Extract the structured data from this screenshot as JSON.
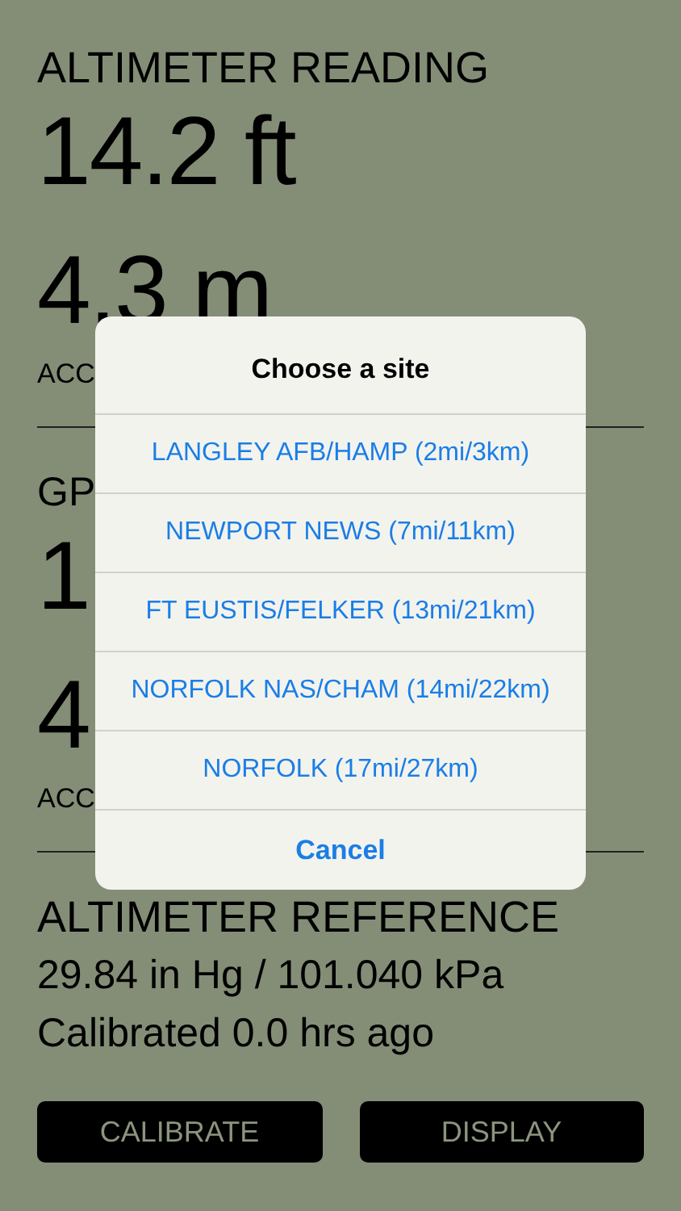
{
  "altimeter_reading": {
    "heading": "ALTIMETER READING",
    "feet": "14.2 ft",
    "meters": "4.3 m",
    "accuracy_label": "ACC"
  },
  "gps": {
    "heading": "GP",
    "feet": "1",
    "meters": "4",
    "accuracy_label": "ACC"
  },
  "altimeter_reference": {
    "heading": "ALTIMETER REFERENCE",
    "pressure": "29.84 in Hg / 101.040 kPa",
    "calibrated": "Calibrated 0.0 hrs ago"
  },
  "buttons": [
    "CALIBRATE",
    "DISPLAY"
  ],
  "dialog": {
    "title": "Choose a site",
    "sites": [
      "LANGLEY AFB/HAMP (2mi/3km)",
      "NEWPORT NEWS (7mi/11km)",
      "FT EUSTIS/FELKER (13mi/21km)",
      "NORFOLK NAS/CHAM (14mi/22km)",
      "NORFOLK (17mi/27km)"
    ],
    "cancel": "Cancel"
  }
}
